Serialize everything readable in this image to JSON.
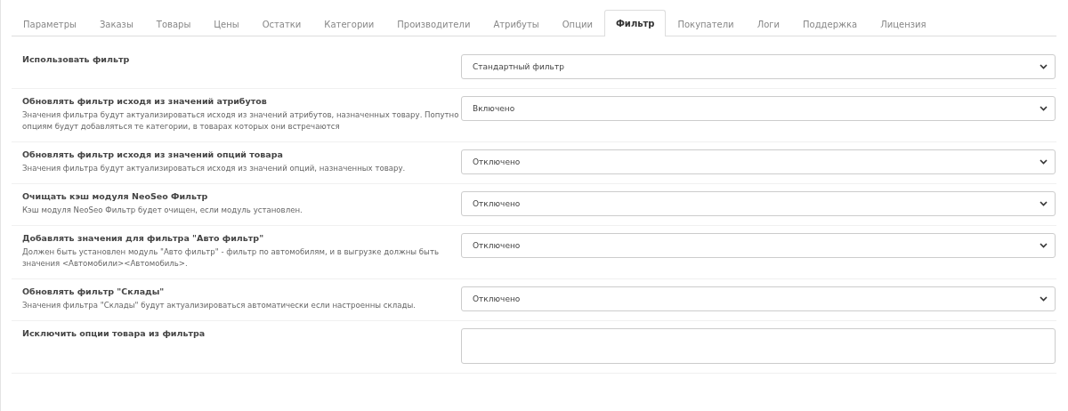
{
  "tabs": [
    {
      "label": "Параметры",
      "selected": false
    },
    {
      "label": "Заказы",
      "selected": false
    },
    {
      "label": "Товары",
      "selected": false
    },
    {
      "label": "Цены",
      "selected": false
    },
    {
      "label": "Остатки",
      "selected": false
    },
    {
      "label": "Категории",
      "selected": false
    },
    {
      "label": "Производители",
      "selected": false
    },
    {
      "label": "Атрибуты",
      "selected": false
    },
    {
      "label": "Опции",
      "selected": false
    },
    {
      "label": "Фильтр",
      "selected": true
    },
    {
      "label": "Покупатели",
      "selected": false
    },
    {
      "label": "Логи",
      "selected": false
    },
    {
      "label": "Поддержка",
      "selected": false
    },
    {
      "label": "Лицензия",
      "selected": false
    }
  ],
  "settings": [
    {
      "kind": "select",
      "label": "Использовать фильтр",
      "value": "Стандартный фильтр"
    },
    {
      "kind": "select",
      "label": "Обновлять фильтр исходя из значений атрибутов",
      "description": "Значения фильтра будут актуализироваться исходя из значений атрибутов, назначенных товару. Попутно опциям будут добавляться те категории, в товарах которых они встречаются",
      "value": "Включено"
    },
    {
      "kind": "select",
      "label": "Обновлять фильтр исходя из значений опций товара",
      "description": "Значения фильтра будут актуализироваться исходя из значений опций, назначенных товару.",
      "value": "Отключено"
    },
    {
      "kind": "select",
      "label": "Очищать кэш модуля NeoSeo Фильтр",
      "description": "Кэш модуля NeoSeo Фильтр будет очищен, если модуль установлен.",
      "value": "Отключено"
    },
    {
      "kind": "select",
      "label": "Добавлять значения для фильтра \"Авто фильтр\"",
      "description": "Должен быть установлен модуль \"Авто фильтр\" - фильтр по автомобилям, и в выгрузке должны быть значения <Автомобили><Автомобиль>.",
      "value": "Отключено"
    },
    {
      "kind": "select",
      "label": "Обновлять фильтр \"Склады\"",
      "description": "Значения фильтра \"Склады\" будут актуализироваться автоматически если настроенны склады.",
      "value": "Отключено"
    },
    {
      "kind": "textarea",
      "label": "Исключить опции товара из фильтра"
    }
  ]
}
